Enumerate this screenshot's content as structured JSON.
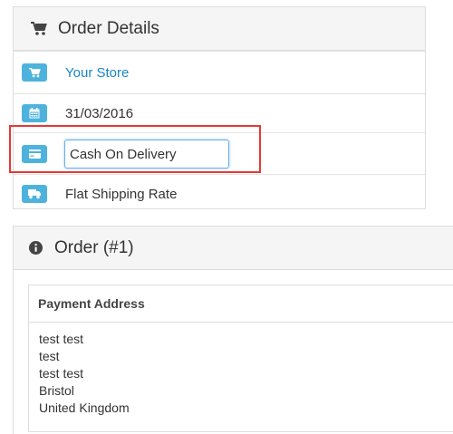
{
  "order_details": {
    "title": "Order Details",
    "store": "Your Store",
    "date": "31/03/2016",
    "payment_method": "Cash On Delivery",
    "shipping_method": "Flat Shipping Rate"
  },
  "order": {
    "title": "Order (#1)",
    "payment_address": {
      "header": "Payment Address",
      "lines": [
        "test test",
        "test",
        "test test",
        "Bristol",
        "United Kingdom"
      ]
    }
  },
  "colors": {
    "badge": "#4db3dd",
    "link": "#1a86c8",
    "highlight": "#e53935",
    "focus": "#66afe9"
  },
  "icons": {
    "heading": "shopping-cart-icon",
    "store": "shopping-cart-icon",
    "date": "calendar-icon",
    "payment": "credit-card-icon",
    "shipping": "truck-icon",
    "order": "info-circle-icon"
  }
}
